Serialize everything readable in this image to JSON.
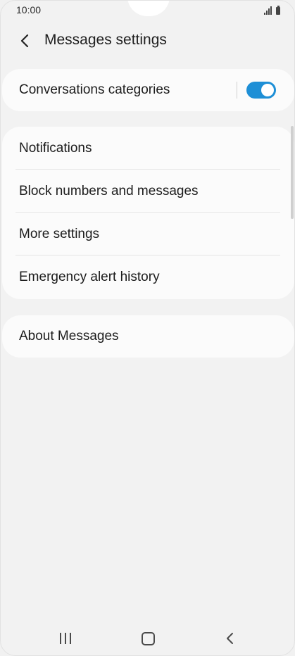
{
  "status_bar": {
    "time": "10:00"
  },
  "header": {
    "back_icon": "chevron-left-icon",
    "title": "Messages settings"
  },
  "sections": [
    {
      "items": [
        {
          "label": "Conversations categories",
          "toggle_on": true
        }
      ]
    },
    {
      "items": [
        {
          "label": "Notifications"
        },
        {
          "label": "Block numbers and messages"
        },
        {
          "label": "More settings"
        },
        {
          "label": "Emergency alert history"
        }
      ]
    },
    {
      "items": [
        {
          "label": "About Messages"
        }
      ]
    }
  ],
  "nav_bar": {
    "icons": [
      "recent-apps-icon",
      "home-icon",
      "back-icon"
    ]
  },
  "colors": {
    "accent": "#1e8fd6",
    "background": "#f2f2f2",
    "card": "#fbfbfb"
  }
}
